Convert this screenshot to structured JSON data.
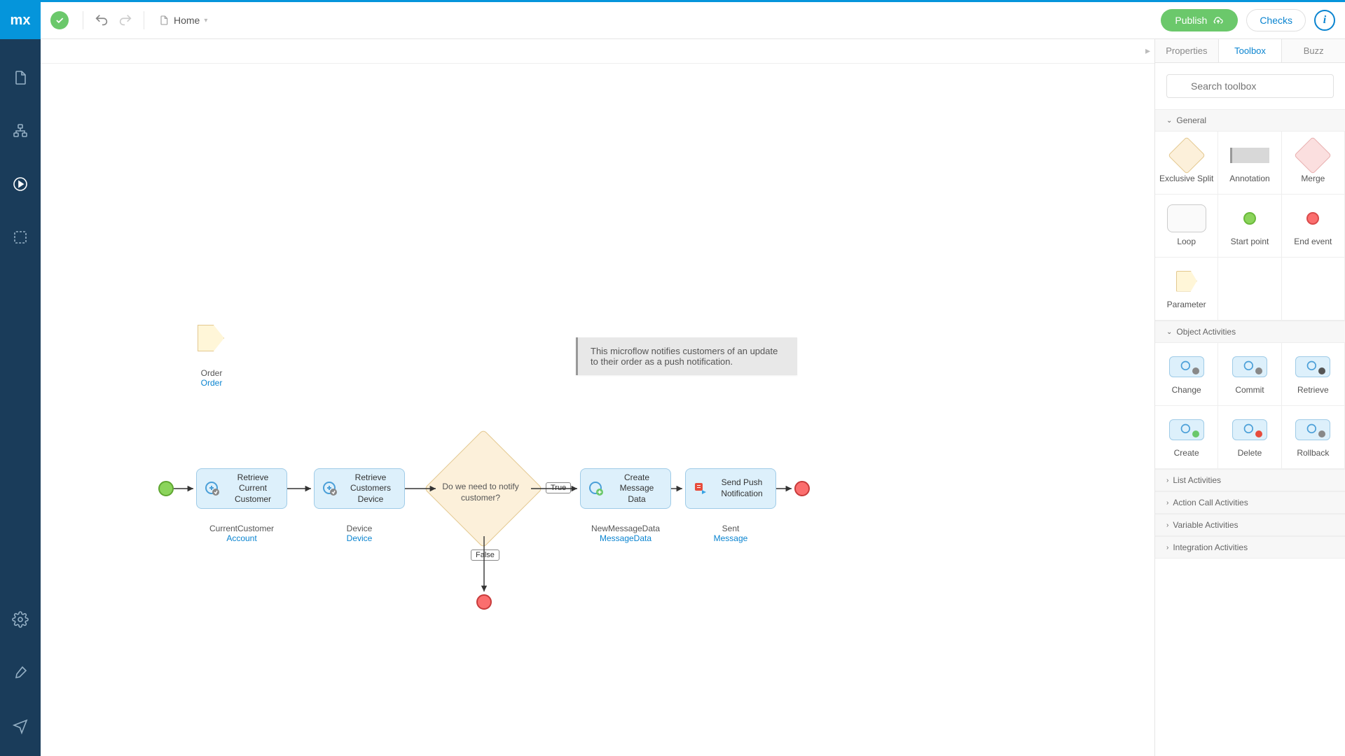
{
  "logo": "mx",
  "toolbar": {
    "publish_label": "Publish",
    "checks_label": "Checks",
    "breadcrumb": "Home"
  },
  "panel": {
    "tabs": {
      "properties": "Properties",
      "toolbox": "Toolbox",
      "buzz": "Buzz"
    },
    "search_placeholder": "Search toolbox",
    "sections": {
      "general": "General",
      "object_activities": "Object Activities",
      "list_activities": "List Activities",
      "action_call_activities": "Action Call Activities",
      "variable_activities": "Variable Activities",
      "integration_activities": "Integration Activities"
    },
    "tools": {
      "exclusive_split": "Exclusive Split",
      "annotation": "Annotation",
      "merge": "Merge",
      "loop": "Loop",
      "start_point": "Start point",
      "end_event": "End event",
      "parameter": "Parameter",
      "change": "Change",
      "commit": "Commit",
      "retrieve": "Retrieve",
      "create": "Create",
      "delete": "Delete",
      "rollback": "Rollback"
    }
  },
  "microflow": {
    "param": {
      "name": "Order",
      "type": "Order"
    },
    "annotation": "This microflow notifies customers of an update to their order as a push notification.",
    "decision": "Do we need to notify customer?",
    "true_label": "True",
    "false_label": "False",
    "activities": {
      "retrieve_customer": {
        "caption": "Retrieve Current Customer",
        "var": "CurrentCustomer",
        "type": "Account"
      },
      "retrieve_device": {
        "caption": "Retrieve Customers Device",
        "var": "Device",
        "type": "Device"
      },
      "create_message": {
        "caption": "Create Message Data",
        "var": "NewMessageData",
        "type": "MessageData"
      },
      "send_push": {
        "caption": "Send Push Notification",
        "var": "Sent",
        "type": "Message"
      }
    }
  }
}
